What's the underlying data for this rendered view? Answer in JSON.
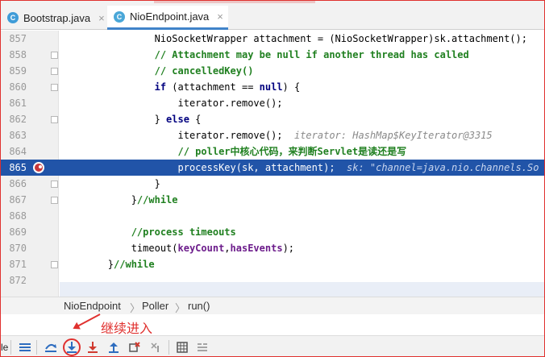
{
  "tabs": [
    {
      "label": "Bootstrap.java",
      "close": "×",
      "icon": "java-class-icon"
    },
    {
      "label": "NioEndpoint.java",
      "close": "×",
      "icon": "java-class-icon"
    }
  ],
  "editor": {
    "lines": [
      {
        "num": "857",
        "parts": [
          [
            "",
            "                NioSocketWrapper attachment = (NioSocketWrapper)sk.attachment();"
          ]
        ]
      },
      {
        "num": "858",
        "parts": [
          [
            "cm",
            "                // Attachment may be null if another thread has called"
          ]
        ]
      },
      {
        "num": "859",
        "parts": [
          [
            "cm",
            "                // cancelledKey()"
          ]
        ]
      },
      {
        "num": "860",
        "parts": [
          [
            "kw",
            "                if"
          ],
          [
            "",
            " (attachment == "
          ],
          [
            "kw",
            "null"
          ],
          [
            "",
            ") {"
          ]
        ]
      },
      {
        "num": "861",
        "parts": [
          [
            "",
            "                    iterator.remove();"
          ]
        ]
      },
      {
        "num": "862",
        "parts": [
          [
            "",
            "                } "
          ],
          [
            "kw",
            "else"
          ],
          [
            "",
            " {"
          ]
        ]
      },
      {
        "num": "863",
        "parts": [
          [
            "",
            "                    iterator.remove();  "
          ],
          [
            "hint",
            "iterator: HashMap$KeyIterator@3315"
          ]
        ]
      },
      {
        "num": "864",
        "parts": [
          [
            "cm",
            "                    // poller中核心代码，来判断Servlet是读还是写"
          ]
        ]
      },
      {
        "num": "865",
        "parts": [
          [
            "",
            "                    processKey(sk, attachment);  "
          ],
          [
            "hint",
            "sk: \"channel=java.nio.channels.So"
          ]
        ]
      },
      {
        "num": "866",
        "parts": [
          [
            "",
            "                }"
          ]
        ]
      },
      {
        "num": "867",
        "parts": [
          [
            "",
            "            }"
          ],
          [
            "cm",
            "//while"
          ]
        ]
      },
      {
        "num": "868",
        "parts": [
          [
            "",
            ""
          ]
        ]
      },
      {
        "num": "869",
        "parts": [
          [
            "cm",
            "            //process timeouts"
          ]
        ]
      },
      {
        "num": "870",
        "parts": [
          [
            "",
            "            timeout("
          ],
          [
            "fld",
            "keyCount"
          ],
          [
            "",
            ","
          ],
          [
            "fld",
            "hasEvents"
          ],
          [
            "",
            ");"
          ]
        ]
      },
      {
        "num": "871",
        "parts": [
          [
            "",
            "        }"
          ],
          [
            "cm",
            "//while"
          ]
        ]
      },
      {
        "num": "872",
        "parts": [
          [
            "",
            ""
          ]
        ]
      }
    ],
    "highlighted_line": "865"
  },
  "breadcrumb": {
    "items": [
      "NioEndpoint",
      "Poller",
      "run()"
    ],
    "separator": "〉"
  },
  "annotation": {
    "label": "继续进入",
    "color": "#e0312f"
  },
  "debug_toolbar": {
    "left_text": "le",
    "buttons": [
      {
        "name": "show-frames-button",
        "icon": "list-lines-icon"
      },
      {
        "name": "step-over-button",
        "icon": "step-over-icon"
      },
      {
        "name": "step-into-button",
        "icon": "step-into-icon"
      },
      {
        "name": "force-step-into-button",
        "icon": "force-step-into-icon"
      },
      {
        "name": "step-out-button",
        "icon": "step-out-icon"
      },
      {
        "name": "drop-frame-button",
        "icon": "drop-frame-icon"
      },
      {
        "name": "run-to-cursor-button",
        "icon": "run-to-cursor-icon"
      },
      {
        "name": "evaluate-expression-button",
        "icon": "calculator-icon"
      },
      {
        "name": "trace-button",
        "icon": "trace-list-icon"
      }
    ]
  },
  "colors": {
    "highlight": "#2154a8",
    "comment": "#208020",
    "keyword": "#00007f",
    "field": "#6c1c8b",
    "accent_red": "#e0312f"
  }
}
